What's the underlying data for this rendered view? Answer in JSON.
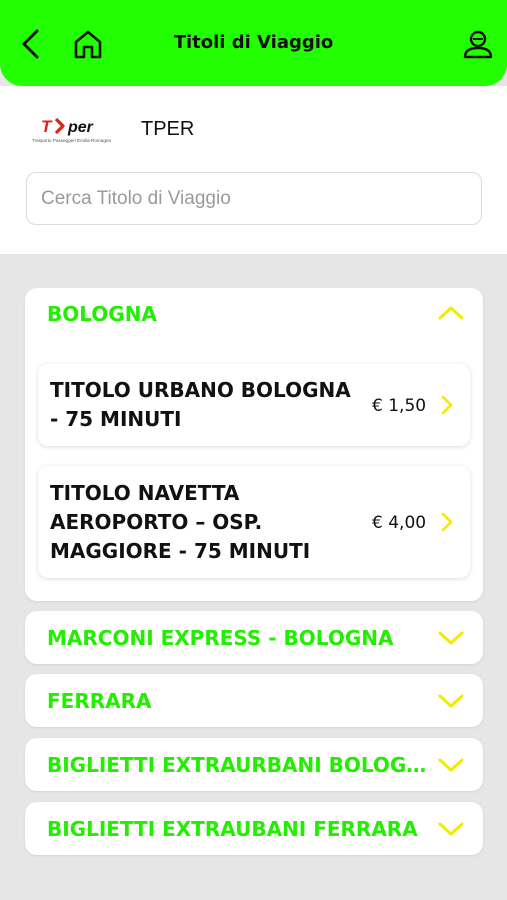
{
  "header": {
    "title": "Titoli di Viaggio",
    "accent_color": "#22ff00",
    "icons": [
      "chevron-left-icon",
      "home-icon",
      "user-icon"
    ]
  },
  "agency": {
    "logo_text": "T per",
    "logo_subtext": "Trasporto Passeggeri Emilia-Romagna",
    "name": "TPER"
  },
  "search": {
    "placeholder": "Cerca Titolo di Viaggio",
    "value": ""
  },
  "sections": [
    {
      "title": "BOLOGNA",
      "expanded": true,
      "items": [
        {
          "name": "TITOLO URBANO BOLOGNA - 75 MINUTI",
          "price": "€ 1,50"
        },
        {
          "name": "TITOLO NAVETTA AEROPORTO – OSP. MAGGIORE - 75 MINUTI",
          "price": "€ 4,00"
        }
      ]
    },
    {
      "title": "MARCONI EXPRESS - BOLOGNA",
      "expanded": false
    },
    {
      "title": "FERRARA",
      "expanded": false
    },
    {
      "title": "BIGLIETTI EXTRAURBANI BOLOGNA",
      "expanded": false
    },
    {
      "title": "BIGLIETTI EXTRAUBANI FERRARA",
      "expanded": false
    }
  ],
  "colors": {
    "section_title": "#22ee00",
    "chevron": "#f2ea00",
    "background": "#e6e6e6"
  }
}
